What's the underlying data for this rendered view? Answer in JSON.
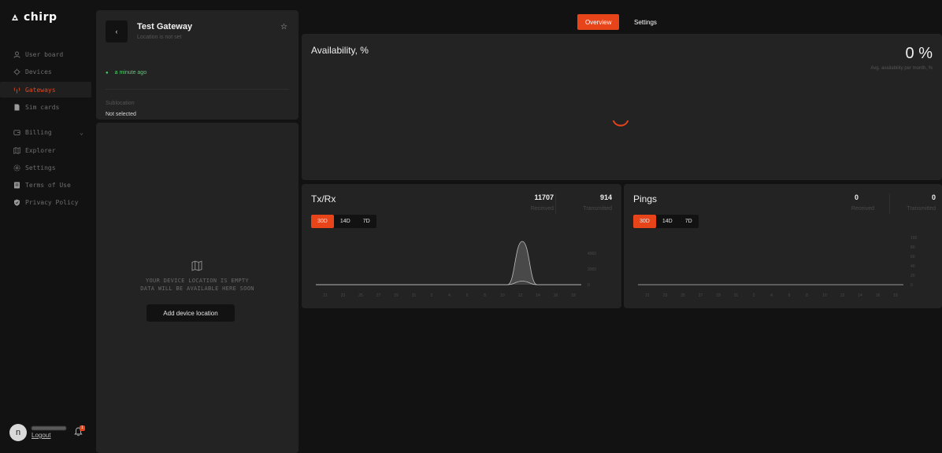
{
  "brand": {
    "name": "chirp"
  },
  "sidebar": {
    "items": [
      {
        "label": "User board",
        "icon": "user-icon"
      },
      {
        "label": "Devices",
        "icon": "chip-icon"
      },
      {
        "label": "Gateways",
        "icon": "antenna-icon",
        "active": true
      },
      {
        "label": "Sim cards",
        "icon": "sim-icon"
      },
      {
        "label": "Billing",
        "icon": "wallet-icon",
        "expandable": true
      },
      {
        "label": "Explorer",
        "icon": "map-icon"
      },
      {
        "label": "Settings",
        "icon": "gear-icon"
      },
      {
        "label": "Terms of Use",
        "icon": "document-icon"
      },
      {
        "label": "Privacy Policy",
        "icon": "shield-icon"
      }
    ],
    "user": {
      "initial": "n",
      "logout_label": "Logout",
      "notifications": "1"
    }
  },
  "gateway": {
    "title": "Test Gateway",
    "location_status": "Location is not set",
    "last_seen": "a minute ago",
    "sublocation_label": "Sublocation",
    "sublocation_value": "Not selected"
  },
  "map": {
    "empty_line1": "YOUR DEVICE LOCATION IS EMPTY",
    "empty_line2": "DATA WILL BE AVAILABLE HERE SOON",
    "add_button": "Add device location"
  },
  "tabs": [
    {
      "label": "Overview",
      "active": true
    },
    {
      "label": "Settings",
      "active": false
    }
  ],
  "availability": {
    "title": "Availability, %",
    "value": "0 %",
    "caption": "Avg. availability per month, %"
  },
  "txrx": {
    "title": "Tx/Rx",
    "received_value": "11707",
    "received_label": "Received",
    "transmitted_value": "914",
    "transmitted_label": "Transmitted",
    "ranges": [
      "30D",
      "14D",
      "7D"
    ],
    "active_range": "30D"
  },
  "pings": {
    "title": "Pings",
    "received_value": "0",
    "received_label": "Received",
    "transmitted_value": "0",
    "transmitted_label": "Transmitted",
    "ranges": [
      "30D",
      "14D",
      "7D"
    ],
    "active_range": "30D"
  },
  "colors": {
    "accent": "#e8441a",
    "status_green": "#4bd36b",
    "card": "#232323",
    "background": "#121212"
  },
  "chart_data": [
    {
      "type": "area",
      "title": "Tx/Rx",
      "x": [
        "21",
        "23",
        "25",
        "27",
        "29",
        "31",
        "2",
        "4",
        "6",
        "8",
        "10",
        "12",
        "14",
        "16",
        "18"
      ],
      "series": [
        {
          "name": "Received",
          "values": [
            0,
            0,
            0,
            0,
            0,
            0,
            0,
            0,
            0,
            0,
            0,
            0,
            0,
            0,
            5500,
            0,
            0,
            0,
            0
          ]
        },
        {
          "name": "Transmitted",
          "values": [
            0,
            0,
            0,
            0,
            0,
            0,
            0,
            0,
            0,
            0,
            0,
            0,
            0,
            0,
            450,
            0,
            0,
            0,
            0
          ]
        }
      ],
      "y_ticks": [
        "4000",
        "2000",
        "0"
      ],
      "ylim": [
        0,
        6000
      ]
    },
    {
      "type": "line",
      "title": "Pings",
      "x": [
        "21",
        "23",
        "25",
        "27",
        "29",
        "31",
        "2",
        "4",
        "6",
        "8",
        "10",
        "12",
        "14",
        "16",
        "18"
      ],
      "series": [
        {
          "name": "Pings",
          "values": [
            0,
            0,
            0,
            0,
            0,
            0,
            0,
            0,
            0,
            0,
            0,
            0,
            0,
            0,
            0,
            0,
            0,
            0,
            0
          ]
        }
      ],
      "y_ticks": [
        "100",
        "80",
        "60",
        "40",
        "20",
        "0"
      ],
      "ylim": [
        0,
        100
      ]
    }
  ]
}
